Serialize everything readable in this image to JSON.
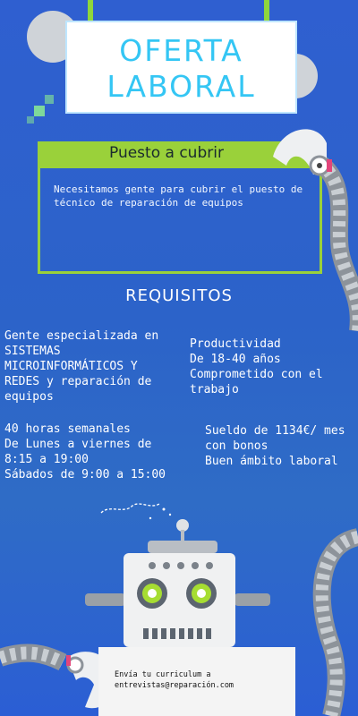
{
  "header": {
    "title_line1": "OFERTA",
    "title_line2": "LABORAL"
  },
  "position": {
    "heading": "Puesto a cubrir",
    "description": "Necesitamos gente para cubrir el puesto de técnico de reparación de equipos"
  },
  "requirements": {
    "heading": "REQUISITOS",
    "left_block_1": [
      "Gente especializada en",
      "SISTEMAS",
      "MICROINFORMÁTICOS Y",
      "REDES y reparación de",
      "equipos"
    ],
    "right_block_1": [
      "Productividad",
      "De 18-40 años",
      "Comprometido con el",
      "trabajo"
    ],
    "left_block_2": [
      "40 horas semanales",
      "De Lunes a viernes de",
      "8:15 a 19:00",
      "Sábados de 9:00 a 15:00"
    ],
    "right_block_2": [
      "Sueldo de 1134€/ mes",
      "con bonos",
      "Buen ámbito laboral"
    ]
  },
  "footer": {
    "line1": "Envía tu curriculum a",
    "line2": "entrevistas@reparación.com"
  },
  "colors": {
    "background": "#2f64cc",
    "title": "#34c6f4",
    "accent_green": "#9ad13a",
    "robot_eye": "#a6dd32"
  },
  "icons": [
    "gear-icon",
    "robot-arm-icon",
    "robot-icon",
    "world-map-icon"
  ]
}
